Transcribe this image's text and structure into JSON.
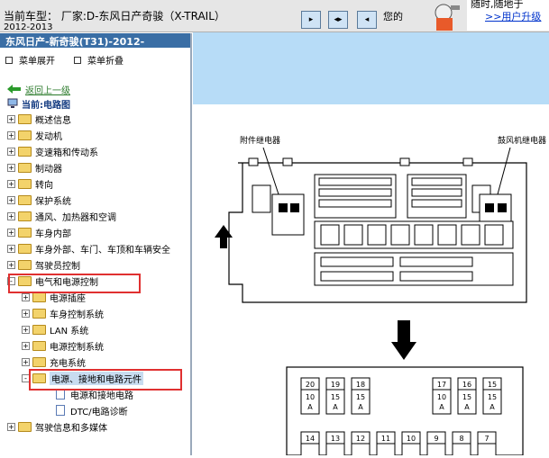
{
  "topbar": {
    "model_label": "当前车型： 厂家:D-东风日产奇骏（X-TRAIL）",
    "years": "2012-2013",
    "notice": "您的",
    "promo_line1": "随时,随地于",
    "promo_link": ">>用户升级"
  },
  "sidebar": {
    "header": "东风日产-新奇骏(T31)-2012-",
    "expand_label": "菜单展开",
    "collapse_label": "菜单折叠",
    "back_label": "返回上一级",
    "current_label": "当前:电路图",
    "tree": [
      {
        "label": "概述信息",
        "level": 0,
        "sign": "+"
      },
      {
        "label": "发动机",
        "level": 0,
        "sign": "+"
      },
      {
        "label": "变速箱和传动系",
        "level": 0,
        "sign": "+"
      },
      {
        "label": "制动器",
        "level": 0,
        "sign": "+"
      },
      {
        "label": "转向",
        "level": 0,
        "sign": "+"
      },
      {
        "label": "保护系统",
        "level": 0,
        "sign": "+"
      },
      {
        "label": "通风、加热器和空调",
        "level": 0,
        "sign": "+"
      },
      {
        "label": "车身内部",
        "level": 0,
        "sign": "+"
      },
      {
        "label": "车身外部、车门、车顶和车辆安全",
        "level": 0,
        "sign": "+"
      },
      {
        "label": "驾驶员控制",
        "level": 0,
        "sign": "+"
      },
      {
        "label": "电气和电源控制",
        "level": 0,
        "sign": "-"
      },
      {
        "label": "电源插座",
        "level": 1,
        "sign": "+"
      },
      {
        "label": "车身控制系统",
        "level": 1,
        "sign": "+"
      },
      {
        "label": "LAN 系统",
        "level": 1,
        "sign": "+"
      },
      {
        "label": "电源控制系统",
        "level": 1,
        "sign": "+"
      },
      {
        "label": "充电系统",
        "level": 1,
        "sign": "+"
      },
      {
        "label": "电源、接地和电路元件",
        "level": 1,
        "sign": "-"
      },
      {
        "label": "电源和接地电路",
        "level": 2,
        "sign": ""
      },
      {
        "label": "DTC/电路诊断",
        "level": 2,
        "sign": ""
      },
      {
        "label": "驾驶信息和多媒体",
        "level": 0,
        "sign": "+"
      }
    ]
  },
  "diagram": {
    "left_relay_label": "附件继电器",
    "right_relay_label": "鼓风机继电器",
    "fuse_row1": [
      {
        "num": "20",
        "amp": "10",
        "unit": "A"
      },
      {
        "num": "19",
        "amp": "15",
        "unit": "A"
      },
      {
        "num": "18",
        "amp": "15",
        "unit": "A"
      },
      {
        "num": "17",
        "amp": "10",
        "unit": "A"
      },
      {
        "num": "16",
        "amp": "15",
        "unit": "A"
      },
      {
        "num": "15",
        "amp": "15",
        "unit": "A"
      }
    ],
    "fuse_row2": [
      "14",
      "13",
      "12",
      "11",
      "10",
      "9",
      "8",
      "7"
    ]
  },
  "colors": {
    "sidebar_header": "#3a6ea5",
    "content_band": "#b7dcf7",
    "highlight": "#e03030",
    "folder": "#f3d36b"
  },
  "icons": [
    "back-arrow-icon",
    "computer-icon",
    "folder-icon",
    "document-icon",
    "expand-plus-icon",
    "collapse-minus-icon",
    "nav-first-icon",
    "nav-prevnext-icon",
    "nav-last-icon",
    "mascot-icon"
  ]
}
